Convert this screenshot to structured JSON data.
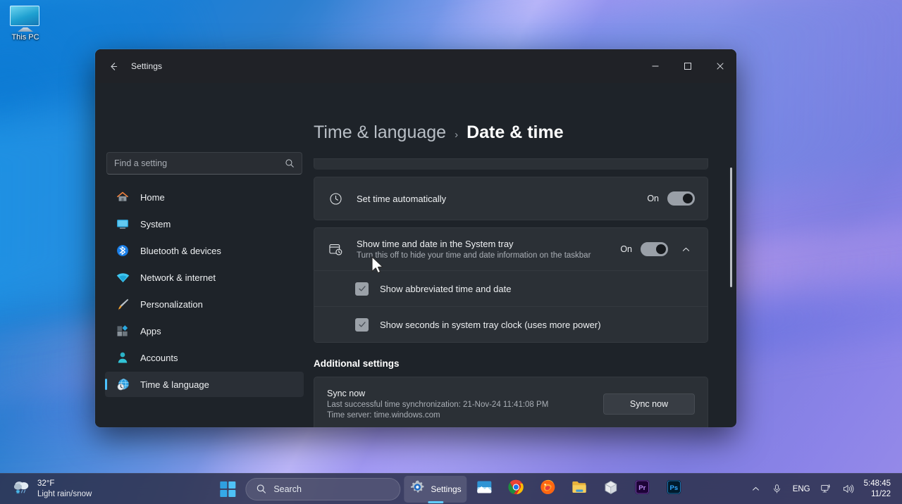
{
  "desktop": {
    "icons": [
      {
        "label": "This PC",
        "icon": "this-pc-monitor-icon"
      }
    ]
  },
  "window": {
    "title": "Settings",
    "back_icon": "back-arrow-icon",
    "controls": {
      "minimize": "minimize-icon",
      "maximize": "maximize-icon",
      "close": "close-icon"
    }
  },
  "sidebar": {
    "search": {
      "placeholder": "Find a setting",
      "value": "",
      "icon": "search-icon"
    },
    "items": [
      {
        "label": "Home",
        "icon": "home-icon",
        "active": false
      },
      {
        "label": "System",
        "icon": "system-monitor-icon",
        "active": false
      },
      {
        "label": "Bluetooth & devices",
        "icon": "bluetooth-icon",
        "active": false
      },
      {
        "label": "Network & internet",
        "icon": "wifi-icon",
        "active": false
      },
      {
        "label": "Personalization",
        "icon": "paintbrush-icon",
        "active": false
      },
      {
        "label": "Apps",
        "icon": "apps-icon",
        "active": false
      },
      {
        "label": "Accounts",
        "icon": "account-person-icon",
        "active": false
      },
      {
        "label": "Time & language",
        "icon": "globe-clock-icon",
        "active": true
      }
    ]
  },
  "main": {
    "breadcrumb": {
      "parent": "Time & language",
      "separator": "›",
      "current": "Date & time"
    },
    "set_time_automatically": {
      "title": "Set time automatically",
      "icon": "clock-icon",
      "state_label": "On",
      "toggle_on": true
    },
    "system_tray": {
      "title": "Show time and date in the System tray",
      "subtitle": "Turn this off to hide your time and date information on the taskbar",
      "icon": "calendar-clock-icon",
      "state_label": "On",
      "toggle_on": true,
      "expander_icon": "chevron-up-icon",
      "sub_options": [
        {
          "label": "Show abbreviated time and date",
          "checked": true
        },
        {
          "label": "Show seconds in system tray clock (uses more power)",
          "checked": true
        }
      ]
    },
    "additional_settings": {
      "heading": "Additional settings",
      "sync": {
        "title": "Sync now",
        "last_sync": "Last successful time synchronization: 21-Nov-24 11:41:08 PM",
        "time_server": "Time server: time.windows.com",
        "button_label": "Sync now"
      }
    },
    "scrollbar": {
      "name": "vertical-scrollbar"
    }
  },
  "taskbar": {
    "weather": {
      "temperature": "32°F",
      "condition": "Light rain/snow",
      "icon": "cloud-snow-icon"
    },
    "start": {
      "icon": "windows-start-icon"
    },
    "search": {
      "placeholder": "Search",
      "icon": "search-icon"
    },
    "apps": [
      {
        "name": "Settings",
        "label": "Settings",
        "icon": "settings-gear-icon",
        "active": true
      },
      {
        "name": "Photos",
        "label": "",
        "icon": "photos-icon",
        "active": false
      },
      {
        "name": "Google Chrome",
        "label": "",
        "icon": "chrome-icon",
        "active": false
      },
      {
        "name": "Mozilla Firefox",
        "label": "",
        "icon": "firefox-icon",
        "active": false
      },
      {
        "name": "File Explorer",
        "label": "",
        "icon": "file-explorer-icon",
        "active": false
      },
      {
        "name": "VirtualBox",
        "label": "",
        "icon": "virtualbox-icon",
        "active": false
      },
      {
        "name": "Adobe Premiere Pro",
        "label": "Pr",
        "icon": "premiere-pro-icon",
        "active": false
      },
      {
        "name": "Adobe Photoshop",
        "label": "Ps",
        "icon": "photoshop-icon",
        "active": false
      }
    ],
    "tray": {
      "overflow_icon": "chevron-up-icon",
      "microphone_icon": "microphone-icon",
      "language": "ENG",
      "network_icon": "network-monitor-icon",
      "volume_icon": "speaker-icon",
      "time": "5:48:45",
      "date": "11/22"
    }
  },
  "colors": {
    "accent": "#4cc2ff",
    "window_bg": "#1e2329",
    "card_bg": "#2b3036",
    "taskbar_bg": "#2b304c"
  }
}
